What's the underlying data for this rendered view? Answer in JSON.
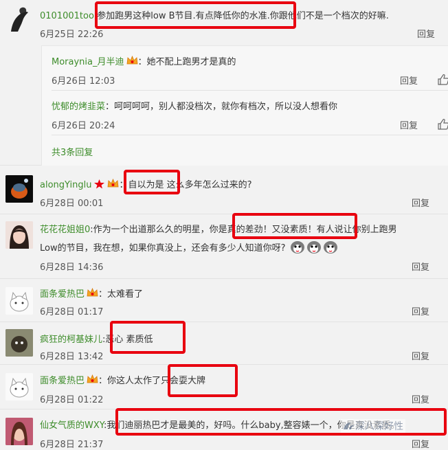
{
  "comments": [
    {
      "user": "0101001too",
      "text": "参加跑男这种low B节目.有点降低你的水准.你跟他们不是一个档次的好嘛.",
      "date": "6月25日 22:26",
      "reply_label": "回复",
      "subreplies": [
        {
          "user": "Moraynia_月半迪",
          "text": "她不配上跑男才是真的",
          "date": "6月26日 12:03",
          "reply_label": "回复"
        },
        {
          "user": "忧郁的烤韭菜",
          "text": "呵呵呵呵，别人都没档次，就你有档次，所以没人想看你",
          "date": "6月26日 20:24",
          "reply_label": "回复"
        }
      ],
      "more_replies": "共3条回复"
    },
    {
      "user": "alongYinglu",
      "text": "自以为是 这么多年怎么过来的?",
      "date": "6月28日 00:01",
      "reply_label": "回复"
    },
    {
      "user": "花花花姐姐0",
      "text_line1": "作为一个出道那么久的明星，你是真的差劲！又没素质！有人说让你别上跑男",
      "text_line2": "Low的节目，我在想，如果你真没上，还会有多少人知道你呀?",
      "date": "6月28日 14:36",
      "reply_label": "回复"
    },
    {
      "user": "面条爱热巴",
      "text": "太难看了",
      "date": "6月28日 01:17",
      "reply_label": "回复"
    },
    {
      "user": "疯狂的柯基妹儿",
      "text": "恶心 素质低",
      "date": "6月28日 13:42",
      "reply_label": "回复"
    },
    {
      "user": "面条爱热巴",
      "text": "你这人太作了只会耍大牌",
      "date": "6月28日 01:22",
      "reply_label": "回复"
    },
    {
      "user": "仙女气质的WXY",
      "text": "我们迪丽热巴才是最美的，好吗。什么baby,整容婊一个，你是真没素质。",
      "date": "6月28日 21:37",
      "reply_label": "回复"
    }
  ],
  "colon": "：",
  "colon_plain": ":",
  "watermark": "深八深好性",
  "colors": {
    "username": "#3d8c2a",
    "highlight": "#e8000f",
    "background": "#f2f2f2"
  },
  "icons": [
    "thumbs-up-icon",
    "vip-crown-icon",
    "emoji-icon",
    "watermark-logo-icon"
  ]
}
